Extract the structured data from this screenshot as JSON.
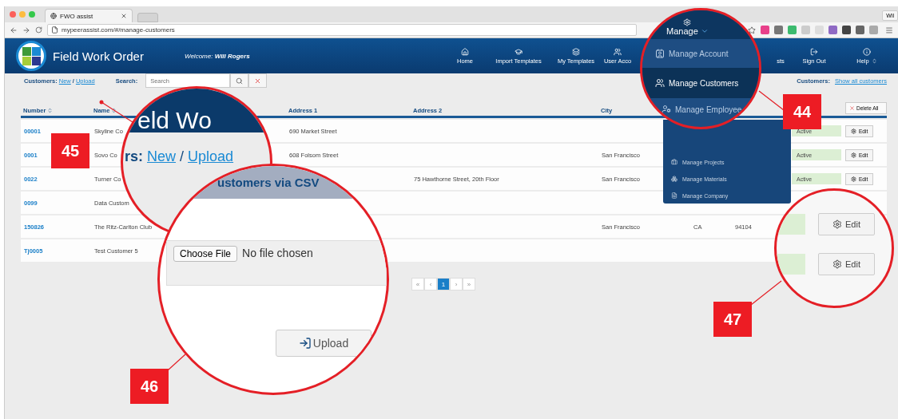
{
  "browser": {
    "tab_title": "FWO assist",
    "url": "mypeerassist.com/#/manage-customers",
    "profile": "Wil"
  },
  "app": {
    "title": "Field Work Order",
    "welcome_label": "Welcome:",
    "user": "Will Rogers"
  },
  "nav": [
    {
      "label": "Home"
    },
    {
      "label": "Import Templates"
    },
    {
      "label": "My Templates"
    },
    {
      "label": "User Acco"
    },
    {
      "label": "sts"
    },
    {
      "label": "Sign Out"
    },
    {
      "label": "Help"
    }
  ],
  "toolbar": {
    "label": "Customers:",
    "links": [
      "New",
      "Upload"
    ],
    "separator": "/",
    "search_label": "Search:",
    "search_placeholder": "Search",
    "filter_label": "Customers:",
    "filter_link": "Show all customers"
  },
  "table": {
    "columns": [
      {
        "label": "Number",
        "sortable": true
      },
      {
        "label": "Name",
        "sortable": true
      },
      {
        "label": "Address 1",
        "sortable": false
      },
      {
        "label": "Address 2",
        "sortable": false
      },
      {
        "label": "City",
        "sortable": false
      }
    ],
    "delete_all": "Delete All",
    "rows": [
      {
        "number": "00001",
        "name": "Skyline Co",
        "address_1": "690 Market Street",
        "active": true,
        "status": "Active",
        "edit": "Edit"
      },
      {
        "number": "0001",
        "name": "Sovo Co",
        "address_1": "608 Folsom Street",
        "city": "San Francisco",
        "active": true,
        "status": "Active",
        "edit": "Edit"
      },
      {
        "number": "0022",
        "name": "Turner Co",
        "address_2": "75 Hawthorne Street, 20th Floor",
        "city": "San Francisco",
        "active": true,
        "status": "Active",
        "edit": "Edit"
      },
      {
        "number": "0099",
        "name": "Data Custom"
      },
      {
        "number": "150826",
        "name": "The Ritz-Carlton Club",
        "city": "San Francisco",
        "state": "CA",
        "zip": "94104"
      },
      {
        "number": "Tj0005",
        "name": "Test Customer 5"
      }
    ]
  },
  "pagination": [
    {
      "label": "«",
      "selected": false
    },
    {
      "label": "‹",
      "selected": false
    },
    {
      "label": "1",
      "selected": true
    },
    {
      "label": "›",
      "selected": false
    },
    {
      "label": "»",
      "selected": false
    }
  ],
  "manage_menu": {
    "items": [
      {
        "label": "Manage Projects"
      },
      {
        "label": "Manage Materials"
      },
      {
        "label": "Manage Company"
      }
    ]
  },
  "magnifiers": {
    "manage": {
      "heading": "Manage",
      "items": [
        {
          "label": "Manage Account",
          "selected": false
        },
        {
          "label": "Manage Customers",
          "selected": true
        },
        {
          "label": "Manage Employee",
          "selected": false
        }
      ]
    },
    "upload_link": {
      "title_fragment": "eld Wo",
      "label": "rs:",
      "links": [
        "New",
        "Upload"
      ],
      "separator": "/"
    },
    "csv_upload": {
      "title": "ustomers via CSV",
      "choose_button": "Choose File",
      "file_status": "No file chosen",
      "upload_button": "Upload"
    },
    "edit_buttons": {
      "rows": [
        {
          "active": true,
          "edit": "Edit"
        },
        {
          "active": true,
          "edit": "Edit"
        }
      ]
    }
  },
  "callouts": [
    "44",
    "45",
    "46",
    "47"
  ]
}
